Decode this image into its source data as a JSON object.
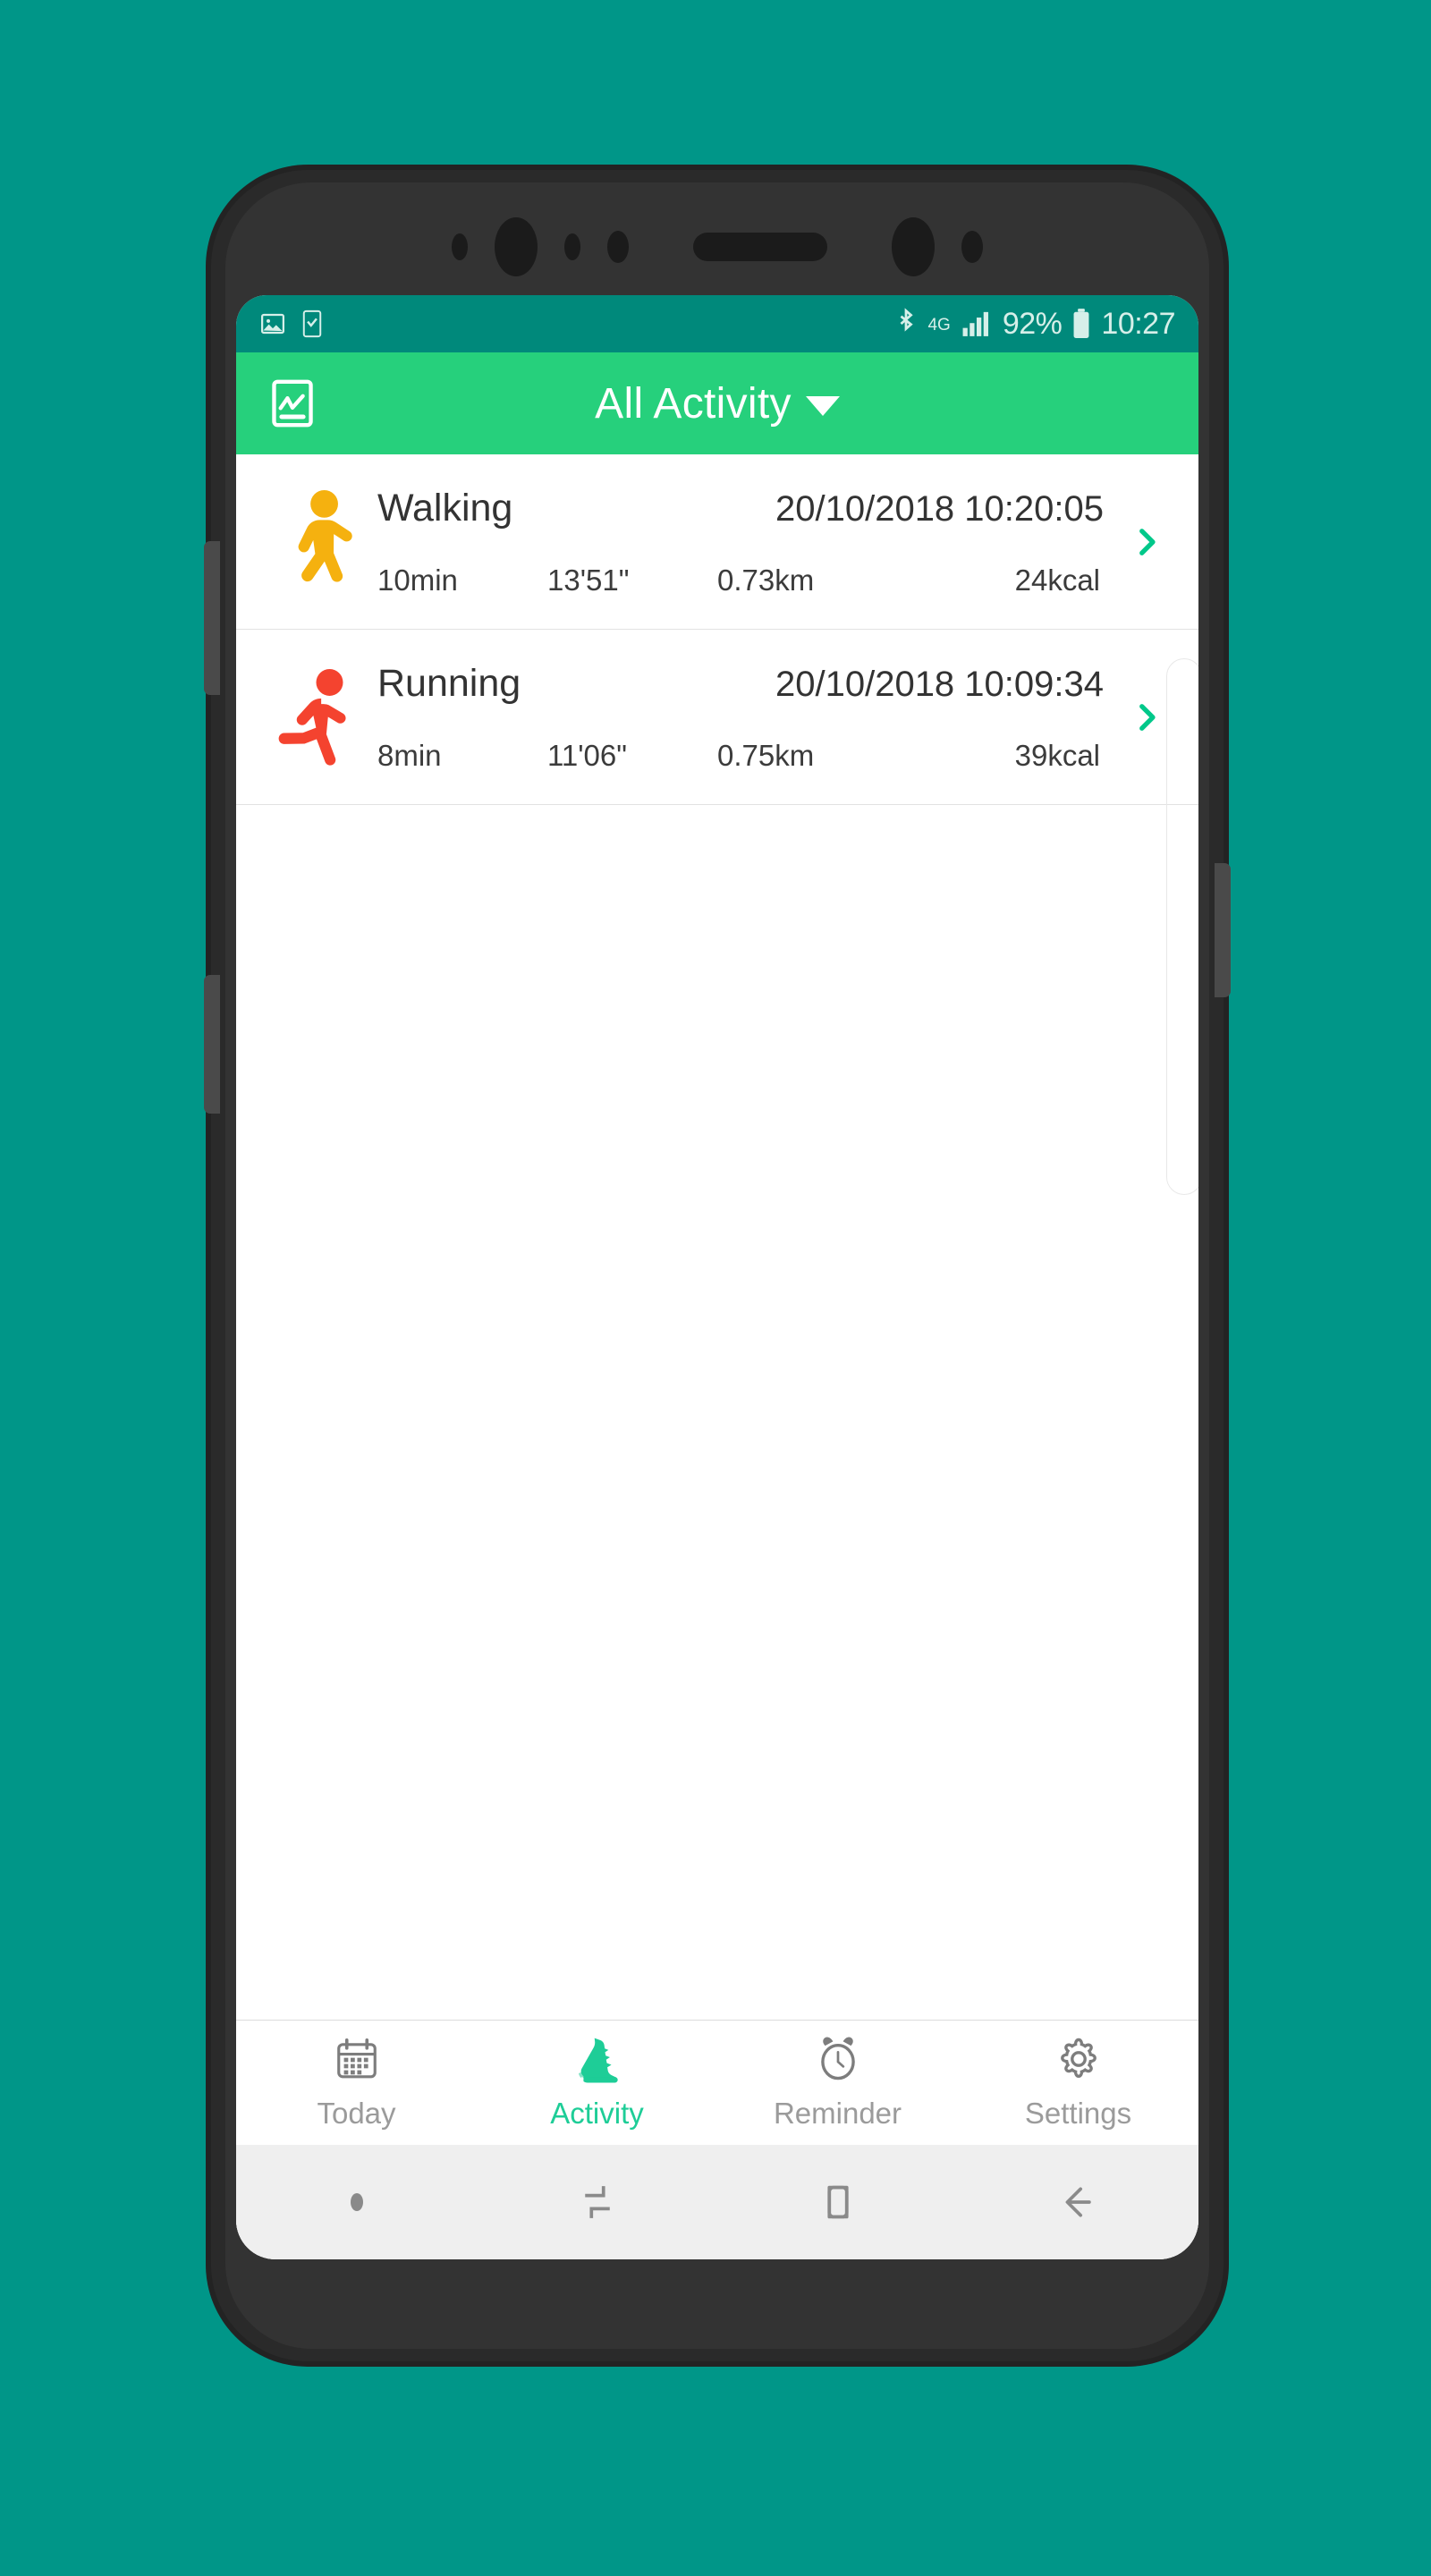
{
  "theme": {
    "page_background": "#009688",
    "appbar_green": "#26D07C",
    "statusbar_green": "#00897B",
    "accent_green": "#1ECD97",
    "walking_color": "#F5B10F",
    "running_color": "#F4432F",
    "chevron_color": "#00C88A",
    "inactive_gray": "#9b9b9b"
  },
  "status_bar": {
    "left_icons": [
      "image-icon",
      "phone-check-icon"
    ],
    "bluetooth_icon": "bluetooth-icon",
    "network_type": "4G",
    "signal_icon": "signal-bars-icon",
    "battery_percent": "92%",
    "battery_icon": "battery-icon",
    "clock": "10:27"
  },
  "appbar": {
    "left_icon": "activity-chart-icon",
    "title": "All Activity",
    "dropdown_icon": "caret-down-icon"
  },
  "activity_list": {
    "columns": [
      "name",
      "datetime",
      "duration",
      "pace",
      "distance",
      "calories"
    ],
    "rows": [
      {
        "icon": "walking-person-icon",
        "name": "Walking",
        "datetime": "20/10/2018 10:20:05",
        "duration": "10min",
        "pace": "13'51\"",
        "distance": "0.73km",
        "calories": "24kcal",
        "chevron": "chevron-right-icon"
      },
      {
        "icon": "running-person-icon",
        "name": "Running",
        "datetime": "20/10/2018 10:09:34",
        "duration": "8min",
        "pace": "11'06\"",
        "distance": "0.75km",
        "calories": "39kcal",
        "chevron": "chevron-right-icon"
      }
    ]
  },
  "bottom_nav": {
    "active_index": 1,
    "items": [
      {
        "label": "Today",
        "icon": "calendar-icon"
      },
      {
        "label": "Activity",
        "icon": "running-shoe-icon"
      },
      {
        "label": "Reminder",
        "icon": "alarm-clock-icon"
      },
      {
        "label": "Settings",
        "icon": "gear-icon"
      }
    ]
  },
  "system_nav": {
    "items": [
      {
        "icon": "dot-indicator-icon"
      },
      {
        "icon": "recents-icon"
      },
      {
        "icon": "home-icon"
      },
      {
        "icon": "back-arrow-icon"
      }
    ]
  }
}
